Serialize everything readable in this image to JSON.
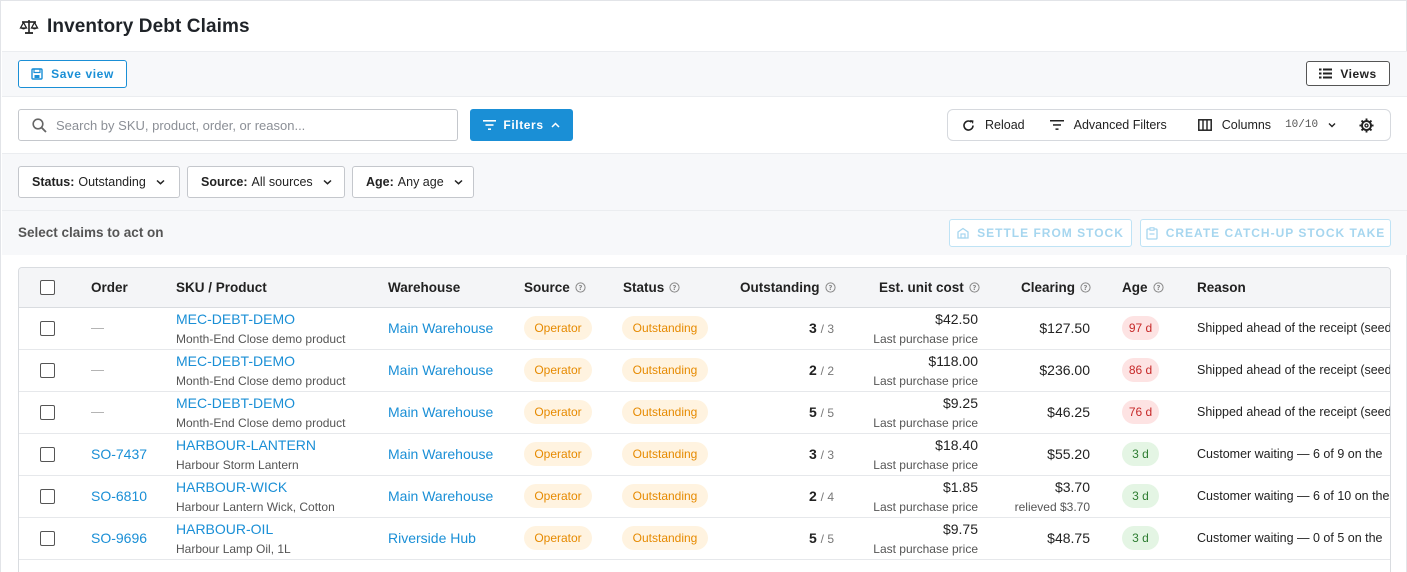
{
  "header": {
    "title": "Inventory Debt Claims",
    "icon": "scale-icon"
  },
  "viewbar": {
    "save_label": "Save view",
    "views_label": "Views"
  },
  "search": {
    "placeholder": "Search by SKU, product, order, or reason...",
    "value": ""
  },
  "filters_label": "Filters",
  "tools": {
    "reload": "Reload",
    "advanced": "Advanced Filters",
    "columns": "Columns",
    "columns_count": "10/10"
  },
  "chips": [
    {
      "key": "Status:",
      "value": "Outstanding"
    },
    {
      "key": "Source:",
      "value": "All sources"
    },
    {
      "key": "Age:",
      "value": "Any age"
    }
  ],
  "selectbar": {
    "label": "Select claims to act on",
    "settle": "SETTLE FROM STOCK",
    "catchup": "CREATE CATCH-UP STOCK TAKE"
  },
  "columns": {
    "order": "Order",
    "sku": "SKU / Product",
    "warehouse": "Warehouse",
    "source": "Source",
    "status": "Status",
    "outstanding": "Outstanding",
    "unit_cost": "Est. unit cost",
    "clearing": "Clearing",
    "age": "Age",
    "reason": "Reason"
  },
  "rows": [
    {
      "order": "—",
      "sku": "MEC-DEBT-DEMO",
      "product": "Month-End Close demo product",
      "warehouse": "Main Warehouse",
      "source": "Operator",
      "status": "Outstanding",
      "outstanding": "3",
      "of": "/ 3",
      "cost": "$42.50",
      "cost_note": "Last purchase price",
      "clearing": "$127.50",
      "clearing_note": "",
      "age": "97 d",
      "age_color": "red",
      "reason": "Shipped ahead of the receipt (seed"
    },
    {
      "order": "—",
      "sku": "MEC-DEBT-DEMO",
      "product": "Month-End Close demo product",
      "warehouse": "Main Warehouse",
      "source": "Operator",
      "status": "Outstanding",
      "outstanding": "2",
      "of": "/ 2",
      "cost": "$118.00",
      "cost_note": "Last purchase price",
      "clearing": "$236.00",
      "clearing_note": "",
      "age": "86 d",
      "age_color": "red",
      "reason": "Shipped ahead of the receipt (seed"
    },
    {
      "order": "—",
      "sku": "MEC-DEBT-DEMO",
      "product": "Month-End Close demo product",
      "warehouse": "Main Warehouse",
      "source": "Operator",
      "status": "Outstanding",
      "outstanding": "5",
      "of": "/ 5",
      "cost": "$9.25",
      "cost_note": "Last purchase price",
      "clearing": "$46.25",
      "clearing_note": "",
      "age": "76 d",
      "age_color": "red",
      "reason": "Shipped ahead of the receipt (seed"
    },
    {
      "order": "SO-7437",
      "sku": "HARBOUR-LANTERN",
      "product": "Harbour Storm Lantern",
      "warehouse": "Main Warehouse",
      "source": "Operator",
      "status": "Outstanding",
      "outstanding": "3",
      "of": "/ 3",
      "cost": "$18.40",
      "cost_note": "Last purchase price",
      "clearing": "$55.20",
      "clearing_note": "",
      "age": "3 d",
      "age_color": "green",
      "reason": "Customer waiting — 6 of 9 on the"
    },
    {
      "order": "SO-6810",
      "sku": "HARBOUR-WICK",
      "product": "Harbour Lantern Wick, Cotton",
      "warehouse": "Main Warehouse",
      "source": "Operator",
      "status": "Outstanding",
      "outstanding": "2",
      "of": "/ 4",
      "cost": "$1.85",
      "cost_note": "Last purchase price",
      "clearing": "$3.70",
      "clearing_note": "relieved $3.70",
      "age": "3 d",
      "age_color": "green",
      "reason": "Customer waiting — 6 of 10 on the"
    },
    {
      "order": "SO-9696",
      "sku": "HARBOUR-OIL",
      "product": "Harbour Lamp Oil, 1L",
      "warehouse": "Riverside Hub",
      "source": "Operator",
      "status": "Outstanding",
      "outstanding": "5",
      "of": "/ 5",
      "cost": "$9.75",
      "cost_note": "Last purchase price",
      "clearing": "$48.75",
      "clearing_note": "",
      "age": "3 d",
      "age_color": "green",
      "reason": "Customer waiting — 0 of 5 on the"
    }
  ],
  "colors": {
    "accent": "#1a8fd6",
    "badge_orange_bg": "#fff3e0",
    "badge_orange_fg": "#e68a00",
    "age_red_bg": "#fde3e3",
    "age_red_fg": "#c62828",
    "age_green_bg": "#e4f5e4",
    "age_green_fg": "#2e7d32"
  }
}
